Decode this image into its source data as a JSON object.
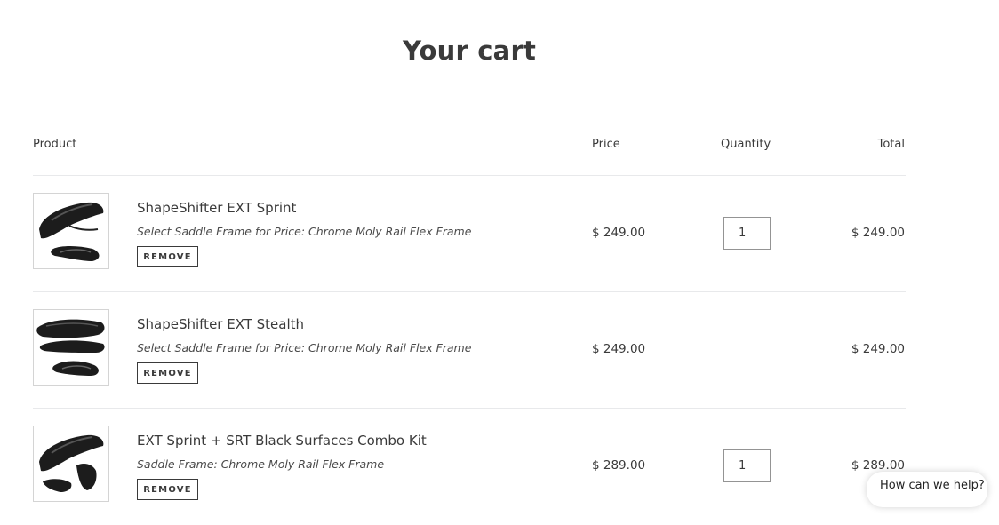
{
  "page": {
    "title": "Your cart"
  },
  "columns": {
    "product": "Product",
    "price": "Price",
    "quantity": "Quantity",
    "total": "Total"
  },
  "items": [
    {
      "name": "ShapeShifter EXT Sprint",
      "variant": "Select Saddle Frame for Price: Chrome Moly Rail Flex Frame",
      "remove_label": "REMOVE",
      "price": "$ 249.00",
      "quantity": "1",
      "total": "$ 249.00",
      "image_icon": "saddle-image"
    },
    {
      "name": "ShapeShifter EXT Stealth",
      "variant": "Select Saddle Frame for Price: Chrome Moly Rail Flex Frame",
      "remove_label": "REMOVE",
      "price": "$ 249.00",
      "total": "$ 249.00",
      "image_icon": "saddle-image"
    },
    {
      "name": "EXT Sprint + SRT Black Surfaces Combo Kit",
      "variant": "Saddle Frame: Chrome Moly Rail Flex Frame",
      "remove_label": "REMOVE",
      "price": "$ 289.00",
      "quantity": "1",
      "total": "$ 289.00",
      "image_icon": "saddle-image"
    }
  ],
  "help_widget": {
    "label": "How can we help?"
  }
}
